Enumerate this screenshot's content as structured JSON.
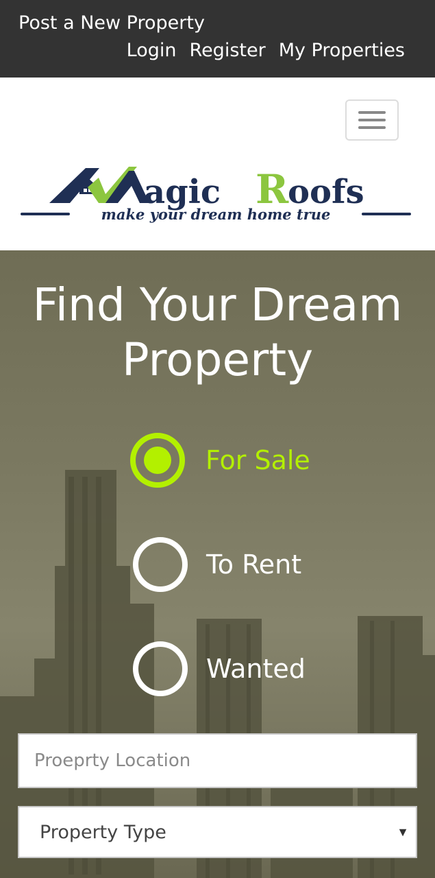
{
  "topbar": {
    "post_label": "Post a New Property",
    "login_label": "Login",
    "register_label": "Register",
    "my_properties_label": "My Properties"
  },
  "logo": {
    "text_part1": "agic",
    "text_part2": "R",
    "text_part3": "oofs",
    "tagline": "make your dream home true"
  },
  "hero": {
    "title": "Find Your Dream Property",
    "listing_types": [
      {
        "label": "For Sale",
        "selected": true
      },
      {
        "label": "To Rent",
        "selected": false
      },
      {
        "label": "Wanted",
        "selected": false
      }
    ],
    "location_placeholder": "Proeprty Location",
    "property_type_value": "Property Type"
  },
  "colors": {
    "accent": "#b3f000",
    "topbar_bg": "#333333",
    "logo_navy": "#1f2f54",
    "logo_green": "#8cc63f"
  },
  "icons": {
    "menu": "hamburger-icon",
    "caret": "caret-down-icon"
  }
}
